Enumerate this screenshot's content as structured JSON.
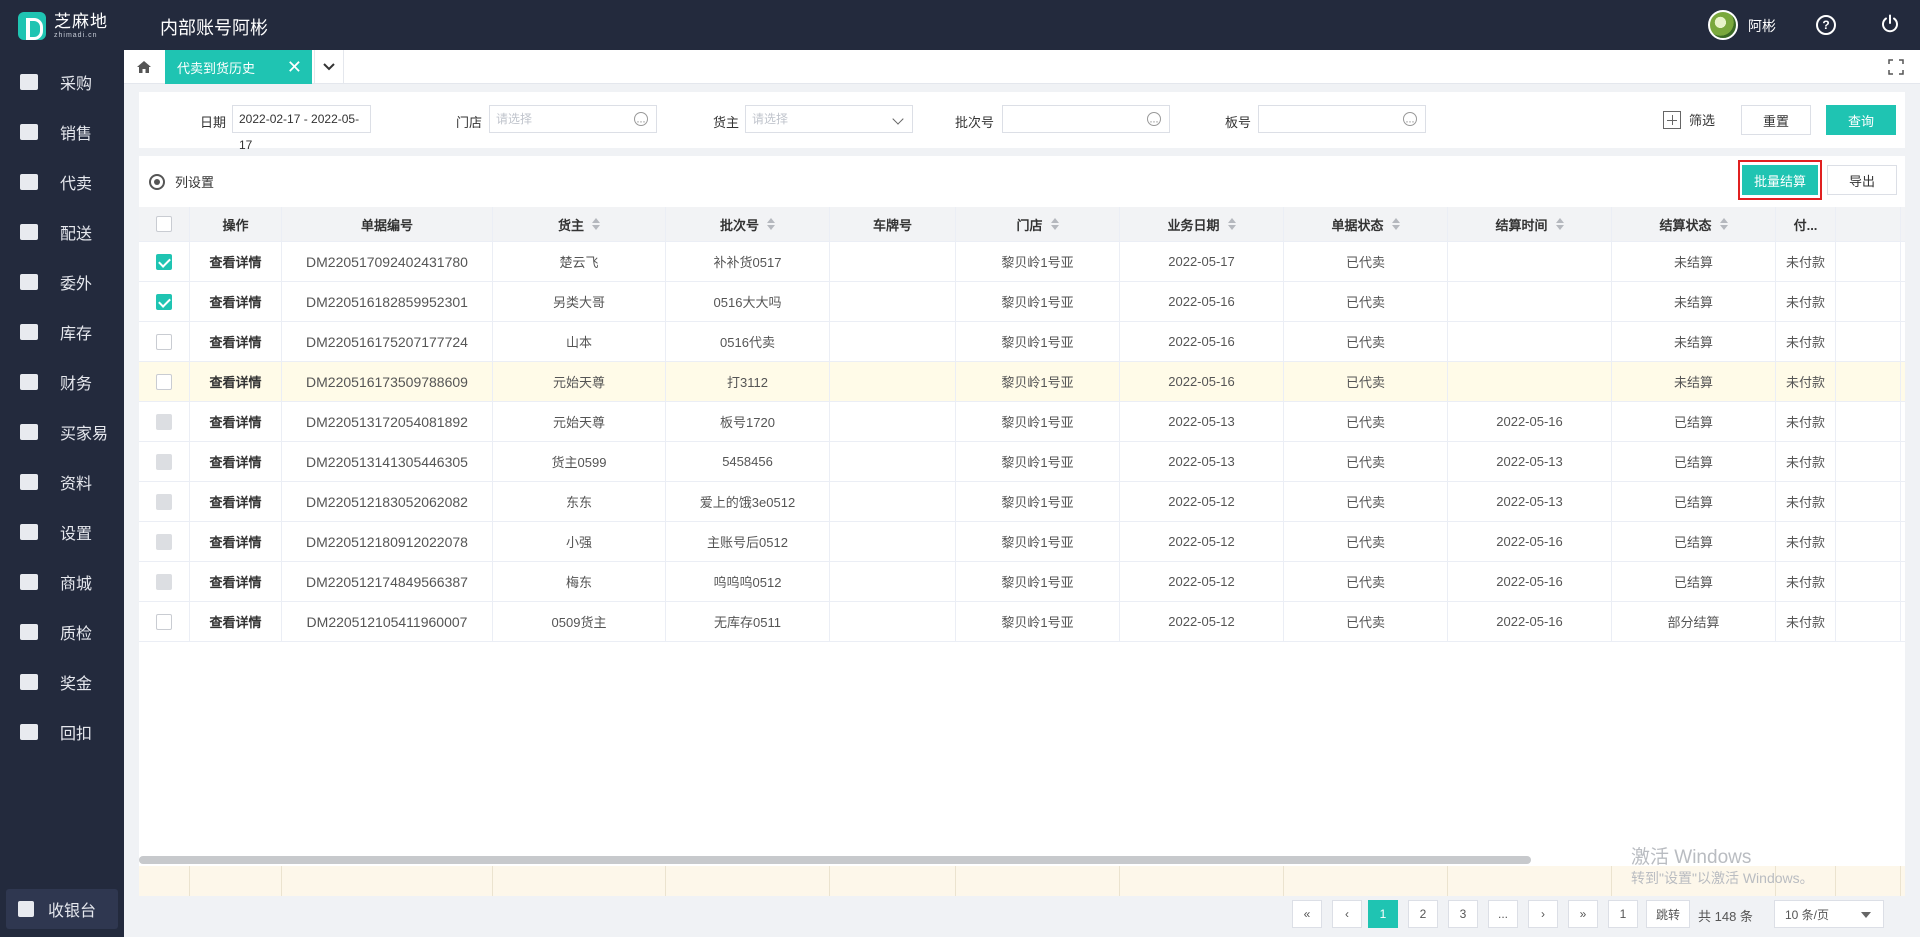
{
  "header": {
    "logo_cn": "芝麻地",
    "logo_en": "zhimadi.cn",
    "app_title": "内部账号阿彬",
    "user_name": "阿彬"
  },
  "sidebar": {
    "items": [
      {
        "label": "采购",
        "icon": "basket-icon"
      },
      {
        "label": "销售",
        "icon": "cart-icon"
      },
      {
        "label": "代卖",
        "icon": "tag-icon"
      },
      {
        "label": "配送",
        "icon": "truck-icon"
      },
      {
        "label": "委外",
        "icon": "building-icon"
      },
      {
        "label": "库存",
        "icon": "warehouse-icon"
      },
      {
        "label": "财务",
        "icon": "money-icon"
      },
      {
        "label": "买家易",
        "icon": "store-icon"
      },
      {
        "label": "资料",
        "icon": "printer-icon"
      },
      {
        "label": "设置",
        "icon": "gear-icon"
      },
      {
        "label": "商城",
        "icon": "shop-icon"
      },
      {
        "label": "质检",
        "icon": "basket-icon"
      },
      {
        "label": "奖金",
        "icon": "store-icon"
      },
      {
        "label": "回扣",
        "icon": "building-icon"
      }
    ],
    "cashier_label": "收银台"
  },
  "tabs": {
    "active_label": "代卖到货历史",
    "close_glyph": "✕"
  },
  "filters": {
    "date_label": "日期",
    "date_value": "2022-02-17 - 2022-05-17",
    "store_label": "门店",
    "store_placeholder": "请选择",
    "owner_label": "货主",
    "owner_placeholder": "请选择",
    "batch_label": "批次号",
    "board_label": "板号",
    "filter_toggle": "筛选",
    "reset_button": "重置",
    "query_button": "查询"
  },
  "toolbar": {
    "column_settings": "列设置",
    "batch_settle_button": "批量结算",
    "export_button": "导出"
  },
  "table": {
    "headers": [
      "操作",
      "单据编号",
      "货主",
      "批次号",
      "车牌号",
      "门店",
      "业务日期",
      "单据状态",
      "结算时间",
      "结算状态",
      "付..."
    ],
    "rows": [
      {
        "checkbox": "checked",
        "op": "查看详情",
        "doc_no": "DM220517092402431780",
        "owner": "楚云飞",
        "batch": "补补货0517",
        "plate": "",
        "store": "黎贝岭1号亚",
        "date": "2022-05-17",
        "doc_status": "已代卖",
        "settle_time": "",
        "settle_status": "未结算",
        "pay": "未付款"
      },
      {
        "checkbox": "checked",
        "op": "查看详情",
        "doc_no": "DM220516182859952301",
        "owner": "另类大哥",
        "batch": "0516大大吗",
        "plate": "",
        "store": "黎贝岭1号亚",
        "date": "2022-05-16",
        "doc_status": "已代卖",
        "settle_time": "",
        "settle_status": "未结算",
        "pay": "未付款"
      },
      {
        "checkbox": "empty",
        "op": "查看详情",
        "doc_no": "DM220516175207177724",
        "owner": "山本",
        "batch": "0516代卖",
        "plate": "",
        "store": "黎贝岭1号亚",
        "date": "2022-05-16",
        "doc_status": "已代卖",
        "settle_time": "",
        "settle_status": "未结算",
        "pay": "未付款"
      },
      {
        "checkbox": "empty",
        "op": "查看详情",
        "doc_no": "DM220516173509788609",
        "owner": "元始天尊",
        "batch": "打3112",
        "plate": "",
        "store": "黎贝岭1号亚",
        "date": "2022-05-16",
        "doc_status": "已代卖",
        "settle_time": "",
        "settle_status": "未结算",
        "pay": "未付款"
      },
      {
        "checkbox": "disabled",
        "op": "查看详情",
        "doc_no": "DM220513172054081892",
        "owner": "元始天尊",
        "batch": "板号1720",
        "plate": "",
        "store": "黎贝岭1号亚",
        "date": "2022-05-13",
        "doc_status": "已代卖",
        "settle_time": "2022-05-16",
        "settle_status": "已结算",
        "pay": "未付款"
      },
      {
        "checkbox": "disabled",
        "op": "查看详情",
        "doc_no": "DM220513141305446305",
        "owner": "货主0599",
        "batch": "5458456",
        "plate": "",
        "store": "黎贝岭1号亚",
        "date": "2022-05-13",
        "doc_status": "已代卖",
        "settle_time": "2022-05-13",
        "settle_status": "已结算",
        "pay": "未付款"
      },
      {
        "checkbox": "disabled",
        "op": "查看详情",
        "doc_no": "DM220512183052062082",
        "owner": "东东",
        "batch": "爱上的饿3e0512",
        "plate": "",
        "store": "黎贝岭1号亚",
        "date": "2022-05-12",
        "doc_status": "已代卖",
        "settle_time": "2022-05-13",
        "settle_status": "已结算",
        "pay": "未付款"
      },
      {
        "checkbox": "disabled",
        "op": "查看详情",
        "doc_no": "DM220512180912022078",
        "owner": "小强",
        "batch": "主账号后0512",
        "plate": "",
        "store": "黎贝岭1号亚",
        "date": "2022-05-12",
        "doc_status": "已代卖",
        "settle_time": "2022-05-16",
        "settle_status": "已结算",
        "pay": "未付款"
      },
      {
        "checkbox": "disabled",
        "op": "查看详情",
        "doc_no": "DM220512174849566387",
        "owner": "梅东",
        "batch": "呜呜呜0512",
        "plate": "",
        "store": "黎贝岭1号亚",
        "date": "2022-05-12",
        "doc_status": "已代卖",
        "settle_time": "2022-05-16",
        "settle_status": "已结算",
        "pay": "未付款"
      },
      {
        "checkbox": "empty",
        "op": "查看详情",
        "doc_no": "DM220512105411960007",
        "owner": "0509货主",
        "batch": "无库存0511",
        "plate": "",
        "store": "黎贝岭1号亚",
        "date": "2022-05-12",
        "doc_status": "已代卖",
        "settle_time": "2022-05-16",
        "settle_status": "部分结算",
        "pay": "未付款"
      }
    ]
  },
  "watermark": {
    "line1": "激活 Windows",
    "line2": "转到\"设置\"以激活 Windows。"
  },
  "pagination": {
    "first": "«",
    "prev": "‹",
    "pages": [
      "1",
      "2",
      "3"
    ],
    "current_page": "1",
    "ellipsis": "...",
    "next": "›",
    "last": "»",
    "jump_value": "1",
    "jump_label": "跳转",
    "total": "共 148 条",
    "page_size": "10 条/页"
  },
  "colors": {
    "accent": "#1fc4b2",
    "sidebar_bg": "#232a3d",
    "highlight_row": "#fffbe8",
    "alert_frame": "#e02020"
  }
}
